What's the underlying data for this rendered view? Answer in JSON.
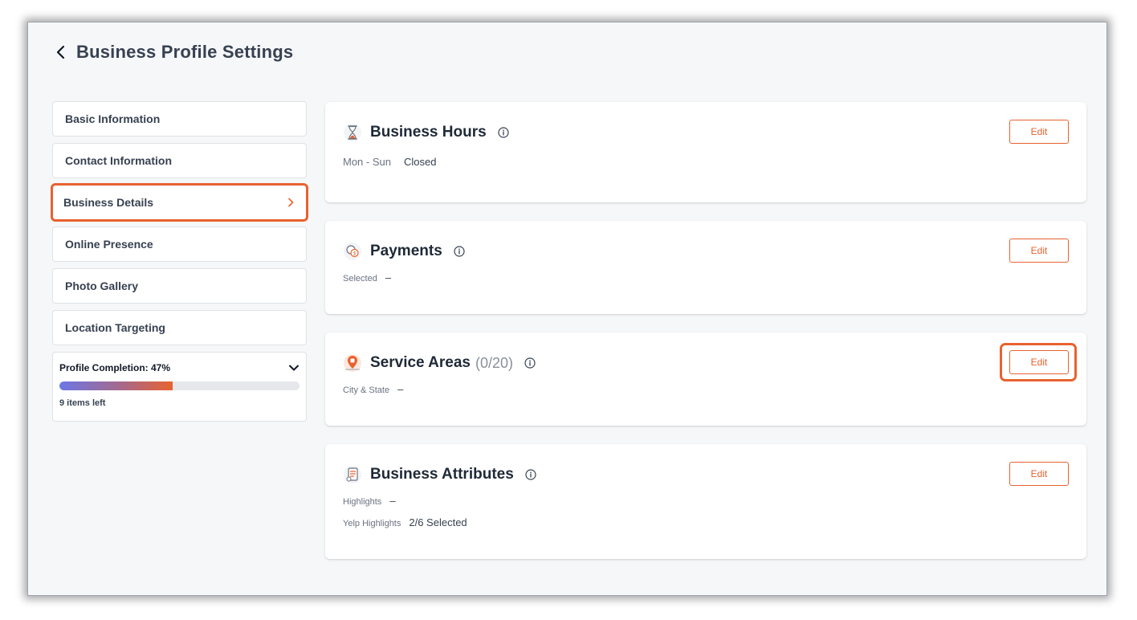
{
  "page_title": "Business Profile Settings",
  "sidebar": {
    "items": [
      {
        "label": "Basic Information"
      },
      {
        "label": "Contact Information"
      },
      {
        "label": "Business Details"
      },
      {
        "label": "Online Presence"
      },
      {
        "label": "Photo Gallery"
      },
      {
        "label": "Location Targeting"
      }
    ],
    "active_item": "Business Details",
    "completion": {
      "label": "Profile Completion: 47%",
      "percent": 47,
      "items_left": "9 items left"
    }
  },
  "cards": {
    "hours": {
      "title": "Business Hours",
      "edit": "Edit",
      "days": "Mon - Sun",
      "status": "Closed"
    },
    "payments": {
      "title": "Payments",
      "edit": "Edit",
      "selected_label": "Selected",
      "selected_value": "–"
    },
    "service_areas": {
      "title": "Service Areas",
      "count": "(0/20)",
      "edit": "Edit",
      "city_label": "City & State",
      "city_value": "–"
    },
    "attributes": {
      "title": "Business Attributes",
      "edit": "Edit",
      "highlights_label": "Highlights",
      "highlights_value": "–",
      "yelp_label": "Yelp Highlights",
      "yelp_value": "2/6 Selected"
    }
  },
  "colors": {
    "accent": "#e8622f",
    "background": "#f6f7f9"
  }
}
